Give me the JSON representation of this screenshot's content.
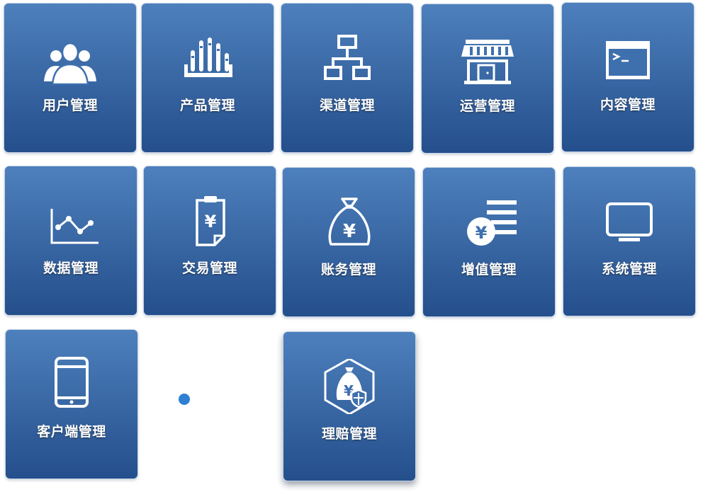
{
  "tiles": [
    {
      "label": "用户管理",
      "icon": "users-icon"
    },
    {
      "label": "产品管理",
      "icon": "product-bars-icon"
    },
    {
      "label": "渠道管理",
      "icon": "network-icon"
    },
    {
      "label": "运营管理",
      "icon": "store-icon"
    },
    {
      "label": "内容管理",
      "icon": "terminal-window-icon"
    },
    {
      "label": "数据管理",
      "icon": "line-chart-icon"
    },
    {
      "label": "交易管理",
      "icon": "clipboard-yen-icon"
    },
    {
      "label": "账务管理",
      "icon": "money-bag-icon"
    },
    {
      "label": "增值管理",
      "icon": "yen-coin-stack-icon"
    },
    {
      "label": "系统管理",
      "icon": "monitor-icon"
    },
    {
      "label": "客户端管理",
      "icon": "tablet-icon"
    },
    {
      "label": "理赔管理",
      "icon": "claim-shield-icon"
    }
  ],
  "colors": {
    "tile_top": "#4d80bd",
    "tile_bottom": "#244f8c",
    "indicator": "#2f7fd2"
  }
}
